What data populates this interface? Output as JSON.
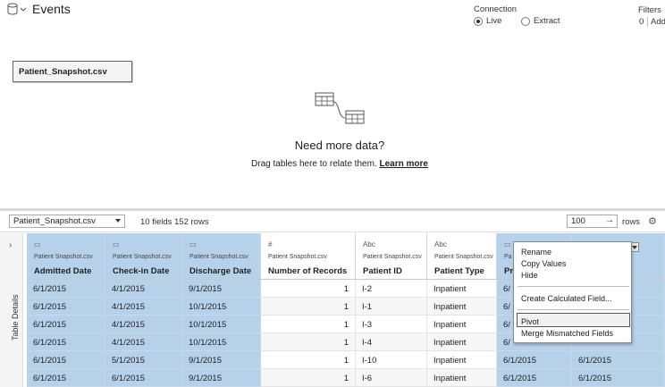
{
  "header": {
    "title": "Events",
    "connection_label": "Connection",
    "live_label": "Live",
    "extract_label": "Extract",
    "filters_label": "Filters",
    "filters_count": "0",
    "filters_add": "Add"
  },
  "canvas": {
    "table_chip": "Patient_Snapshot.csv",
    "heading": "Need more data?",
    "hint": "Drag tables here to relate them.",
    "learn_more": "Learn more"
  },
  "toolbar": {
    "datasource_select": "Patient_Snapshot.csv",
    "fields_info": "10 fields 152 rows",
    "rows_value": "100",
    "rows_go": "→",
    "rows_label": "rows"
  },
  "side": {
    "label": "Table Details"
  },
  "grid": {
    "columns": [
      {
        "type": "▭",
        "source": "Patient Snapshot.csv",
        "name": "Admitted Date",
        "selected": true,
        "values": [
          "6/1/2015",
          "6/1/2015",
          "6/1/2015",
          "6/1/2015",
          "6/1/2015",
          "6/1/2015"
        ]
      },
      {
        "type": "▭",
        "source": "Patient Snapshot.csv",
        "name": "Check-in Date",
        "selected": true,
        "values": [
          "4/1/2015",
          "4/1/2015",
          "4/1/2015",
          "4/1/2015",
          "5/1/2015",
          "6/1/2015"
        ]
      },
      {
        "type": "▭",
        "source": "Patient Snapshot.csv",
        "name": "Discharge Date",
        "selected": true,
        "values": [
          "9/1/2015",
          "10/1/2015",
          "10/1/2015",
          "10/1/2015",
          "9/1/2015",
          "9/1/2015"
        ]
      },
      {
        "type": "#",
        "source": "Patient Snapshot.csv",
        "name": "Number of Records",
        "selected": false,
        "values": [
          "1",
          "1",
          "1",
          "1",
          "1",
          "1"
        ]
      },
      {
        "type": "Abc",
        "source": "Patient Snapshot.csv",
        "name": "Patient ID",
        "selected": false,
        "values": [
          "I-2",
          "I-1",
          "I-3",
          "I-4",
          "I-10",
          "I-6"
        ]
      },
      {
        "type": "Abc",
        "source": "Patient Snapshot.csv",
        "name": "Patient Type",
        "selected": false,
        "values": [
          "Inpatient",
          "Inpatient",
          "Inpatient",
          "Inpatient",
          "Inpatient",
          "Inpatient"
        ]
      },
      {
        "type": "▭",
        "source": "Pa",
        "name": "Pr",
        "selected": true,
        "values": [
          "6/",
          "6/",
          "6/",
          "6/",
          "6/1/2015",
          "6/1/2015"
        ]
      },
      {
        "type": "",
        "source": "sv",
        "name": "",
        "selected": true,
        "values": [
          "",
          "",
          "",
          "",
          "6/1/2015",
          "6/1/2015"
        ]
      }
    ]
  },
  "context_menu": {
    "items": [
      "Rename",
      "Copy Values",
      "Hide",
      "Create Calculated Field...",
      "Pivot",
      "Merge Mismatched Fields"
    ]
  }
}
